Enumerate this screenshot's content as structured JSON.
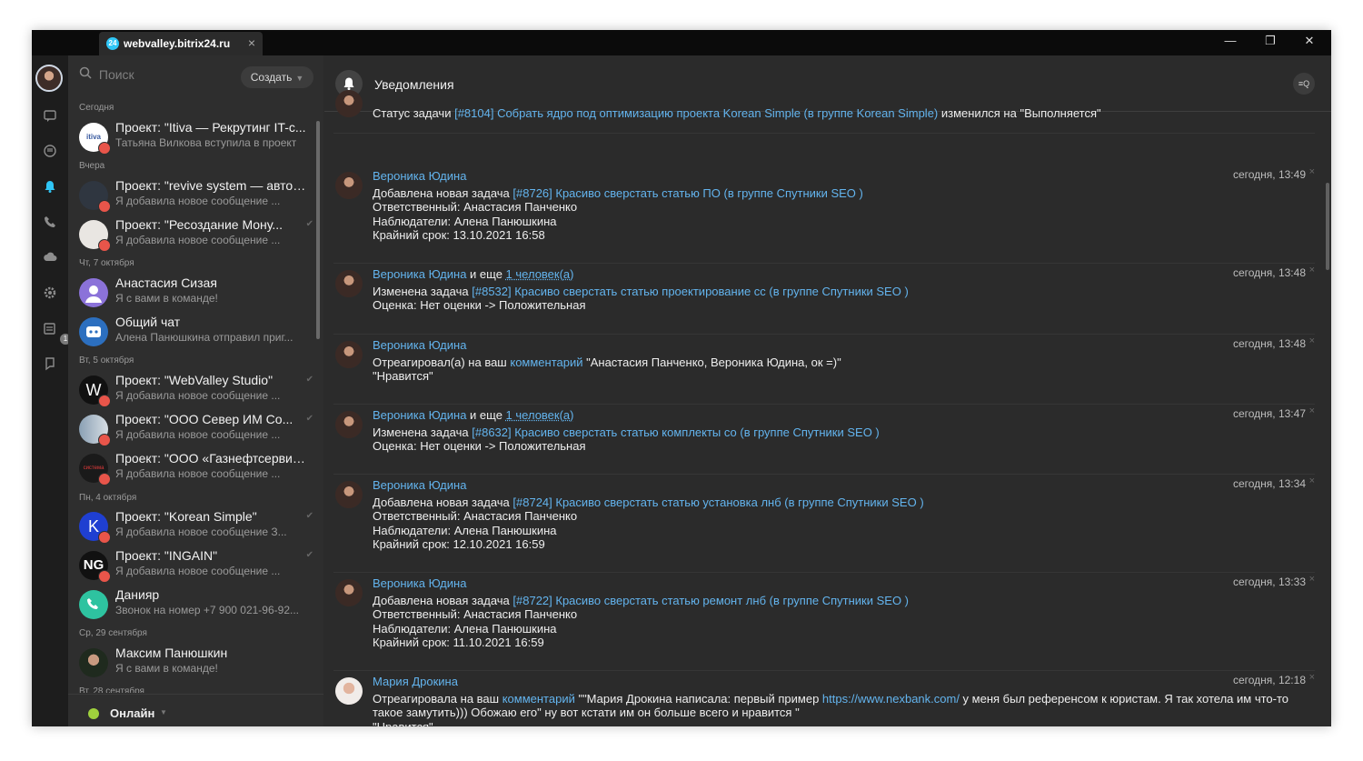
{
  "window": {
    "tab_title": "webvalley.bitrix24.ru",
    "tab_icon_text": "24",
    "controls": {
      "minimize": "—",
      "restore": "❐",
      "close": "✕"
    }
  },
  "sidebar": {
    "calendar_badge": "1"
  },
  "list": {
    "search_placeholder": "Поиск",
    "create_label": "Создать",
    "groups": [
      {
        "date": "Сегодня"
      },
      {
        "date": "Вчера"
      },
      {
        "date": "Чт, 7 октября"
      },
      {
        "date": "Вт, 5 октября"
      },
      {
        "date": "Пн, 4 октября"
      },
      {
        "date": "Ср, 29 сентября"
      },
      {
        "date": "Вт, 28 сентября"
      }
    ],
    "items": [
      {
        "title": "Проект: \"Itiva — Рекрутинг IT-с...",
        "subtitle": "Татьяна Вилкова вступила в проект",
        "avatar_text": "itiva"
      },
      {
        "title": "Проект: \"revive system — автор...",
        "subtitle": "Я добавила новое сообщение ...",
        "avatar_text": ""
      },
      {
        "title": "Проект: \"Ресоздание Мону...",
        "subtitle": "Я добавила новое сообщение ...",
        "avatar_text": ""
      },
      {
        "title": "Анастасия Сизая",
        "subtitle": "Я с вами в команде!",
        "avatar_text": ""
      },
      {
        "title": "Общий чат",
        "subtitle": "Алена Панюшкина отправил приг...",
        "avatar_text": ""
      },
      {
        "title": "Проект: \"WebValley Studio\"",
        "subtitle": "Я добавила новое сообщение ...",
        "avatar_text": "W"
      },
      {
        "title": "Проект: \"ООО Север ИМ Со...",
        "subtitle": "Я добавила новое сообщение ...",
        "avatar_text": ""
      },
      {
        "title": "Проект: \"ООО «Газнефтсервис»\"",
        "subtitle": "Я добавила новое сообщение ...",
        "avatar_text": "система"
      },
      {
        "title": "Проект: \"Korean Simple\"",
        "subtitle": "Я добавила новое сообщение З...",
        "avatar_text": "K"
      },
      {
        "title": "Проект: \"INGAIN\"",
        "subtitle": "Я добавила новое сообщение ...",
        "avatar_text": "NG"
      },
      {
        "title": "Данияр",
        "subtitle": "Звонок на номер +7 900 021-96-92...",
        "avatar_text": ""
      },
      {
        "title": "Максим Панюшкин",
        "subtitle": "Я с вами в команде!",
        "avatar_text": ""
      }
    ],
    "status": "Онлайн"
  },
  "main": {
    "title": "Уведомления",
    "notifications": [
      {
        "parts": [
          {
            "t": "Статус задачи "
          },
          {
            "t": "[#8104] Собрать ядро под оптимизацию проекта Korean Simple (в группе Korean Simple)",
            "link": true
          },
          {
            "t": " изменился на \"Выполняется\""
          }
        ],
        "lines": [],
        "time": ""
      },
      {
        "name": "Вероника Юдина",
        "parts": [
          {
            "t": "Добавлена новая задача "
          },
          {
            "t": "[#8726] Красиво сверстать статью ПО (в группе Спутники SEO )",
            "link": true
          }
        ],
        "lines": [
          "Ответственный: Анастасия Панченко",
          "Наблюдатели: Алена Панюшкина",
          "Крайний срок: 13.10.2021 16:58"
        ],
        "time": "сегодня, 13:49"
      },
      {
        "name": "Вероника Юдина",
        "name_suffix": " и еще ",
        "more": "1 человек(а)",
        "parts": [
          {
            "t": "Изменена задача "
          },
          {
            "t": "[#8532] Красиво сверстать статью проектирование сс (в группе Спутники SEO )",
            "link": true
          }
        ],
        "lines": [
          "Оценка: Нет оценки -> Положительная"
        ],
        "time": "сегодня, 13:48"
      },
      {
        "name": "Вероника Юдина",
        "parts": [
          {
            "t": "Отреагировал(а) на ваш "
          },
          {
            "t": "комментарий",
            "link": true
          },
          {
            "t": " \"Анастасия Панченко, Вероника Юдина, ок =)\""
          }
        ],
        "lines": [
          "\"Нравится\""
        ],
        "time": "сегодня, 13:48"
      },
      {
        "name": "Вероника Юдина",
        "name_suffix": " и еще ",
        "more": "1 человек(а)",
        "parts": [
          {
            "t": "Изменена задача "
          },
          {
            "t": "[#8632] Красиво сверстать статью комплекты со (в группе Спутники SEO )",
            "link": true
          }
        ],
        "lines": [
          "Оценка: Нет оценки -> Положительная"
        ],
        "time": "сегодня, 13:47"
      },
      {
        "name": "Вероника Юдина",
        "parts": [
          {
            "t": "Добавлена новая задача "
          },
          {
            "t": "[#8724] Красиво сверстать статью установка лнб (в группе Спутники SEO )",
            "link": true
          }
        ],
        "lines": [
          "Ответственный: Анастасия Панченко",
          "Наблюдатели: Алена Панюшкина",
          "Крайний срок: 12.10.2021 16:59"
        ],
        "time": "сегодня, 13:34"
      },
      {
        "name": "Вероника Юдина",
        "parts": [
          {
            "t": "Добавлена новая задача "
          },
          {
            "t": "[#8722] Красиво сверстать статью ремонт лнб (в группе Спутники SEO )",
            "link": true
          }
        ],
        "lines": [
          "Ответственный: Анастасия Панченко",
          "Наблюдатели: Алена Панюшкина",
          "Крайний срок: 11.10.2021 16:59"
        ],
        "time": "сегодня, 13:33"
      },
      {
        "name": "Мария Дрокина",
        "parts": [
          {
            "t": "Отреагировала на ваш "
          },
          {
            "t": "комментарий",
            "link": true
          },
          {
            "t": " \"\"Мария Дрокина написала: первый пример "
          },
          {
            "t": "https://www.nexbank.com/",
            "link": true
          },
          {
            "t": " у меня был референсом к юристам. Я так хотела им что-то такое замутить))) Обожаю его\" ну вот кстати им он больше всего и нравится \""
          }
        ],
        "lines": [
          "\"Нравится\""
        ],
        "time": "сегодня, 12:18"
      }
    ]
  },
  "colors": {
    "accent": "#2fc6f6",
    "link": "#63b4ee",
    "online": "#9fd13d",
    "badge": "#e8554a"
  },
  "icons": [
    "chat-icon",
    "open-lines-icon",
    "bell-icon",
    "phone-icon",
    "cloud-icon",
    "settings-icon",
    "calendar-icon",
    "pin-icon",
    "search-icon",
    "filter-search-icon",
    "copy-icon"
  ]
}
